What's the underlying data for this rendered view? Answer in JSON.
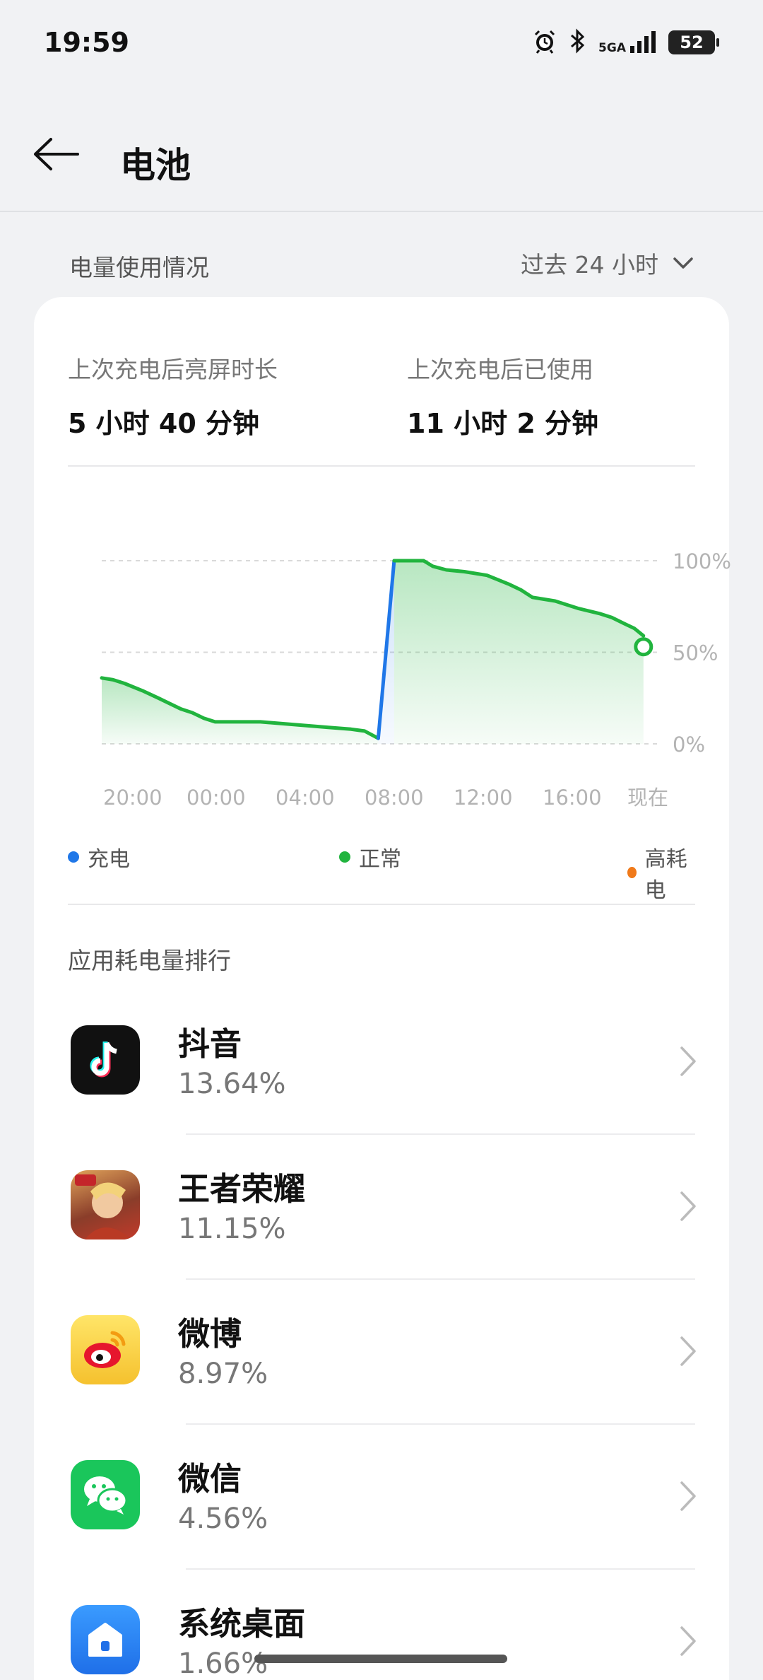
{
  "status": {
    "time": "19:59",
    "network": "5GA",
    "battery": "52"
  },
  "header": {
    "title": "电池"
  },
  "usage": {
    "section_title": "电量使用情况",
    "range": "过去 24 小时"
  },
  "stats": [
    {
      "label": "上次充电后亮屏时长",
      "value": "5 小时 40 分钟"
    },
    {
      "label": "上次充电后已使用",
      "value": "11 小时 2 分钟"
    }
  ],
  "chart_data": {
    "type": "line",
    "x_ticks": [
      "20:00",
      "00:00",
      "04:00",
      "08:00",
      "12:00",
      "16:00",
      "现在"
    ],
    "y_ticks": [
      "100%",
      "50%",
      "0%"
    ],
    "ylim": [
      0,
      100
    ],
    "series": [
      {
        "name": "正常",
        "color": "#21b43e",
        "points": [
          [
            0,
            36
          ],
          [
            0.5,
            35
          ],
          [
            1,
            33
          ],
          [
            1.8,
            29
          ],
          [
            2.5,
            25
          ],
          [
            3.5,
            19
          ],
          [
            4,
            17
          ],
          [
            4.5,
            14
          ],
          [
            5,
            12
          ],
          [
            6,
            12
          ],
          [
            7,
            12
          ],
          [
            8,
            11
          ],
          [
            9,
            10
          ],
          [
            10,
            9
          ],
          [
            11,
            8
          ],
          [
            11.6,
            7
          ],
          [
            11.9,
            5
          ],
          [
            12.2,
            3
          ]
        ]
      },
      {
        "name": "充电",
        "color": "#1f77e8",
        "points": [
          [
            12.2,
            3
          ],
          [
            12.9,
            100
          ]
        ]
      },
      {
        "name": "正常",
        "color": "#21b43e",
        "points": [
          [
            12.9,
            100
          ],
          [
            13.5,
            100
          ],
          [
            14.2,
            100
          ],
          [
            14.6,
            97
          ],
          [
            15.2,
            95
          ],
          [
            16,
            94
          ],
          [
            17,
            92
          ],
          [
            18,
            87
          ],
          [
            18.5,
            84
          ],
          [
            19,
            80
          ],
          [
            20,
            78
          ],
          [
            21,
            74
          ],
          [
            22,
            71
          ],
          [
            22.5,
            69
          ],
          [
            23,
            66
          ],
          [
            23.5,
            63
          ],
          [
            23.9,
            59
          ]
        ]
      }
    ],
    "end_marker": [
      23.9,
      53
    ]
  },
  "legend": [
    {
      "label": "充电",
      "color": "#1f77e8"
    },
    {
      "label": "正常",
      "color": "#21b43e"
    },
    {
      "label": "高耗电",
      "color": "#f07a1a"
    }
  ],
  "ranking": {
    "title": "应用耗电量排行",
    "apps": [
      {
        "name": "抖音",
        "percent": "13.64%",
        "icon": "douyin-icon"
      },
      {
        "name": "王者荣耀",
        "percent": "11.15%",
        "icon": "honor-of-kings-icon"
      },
      {
        "name": "微博",
        "percent": "8.97%",
        "icon": "weibo-icon"
      },
      {
        "name": "微信",
        "percent": "4.56%",
        "icon": "wechat-icon"
      },
      {
        "name": "系统桌面",
        "percent": "1.66%",
        "icon": "launcher-icon"
      }
    ]
  }
}
